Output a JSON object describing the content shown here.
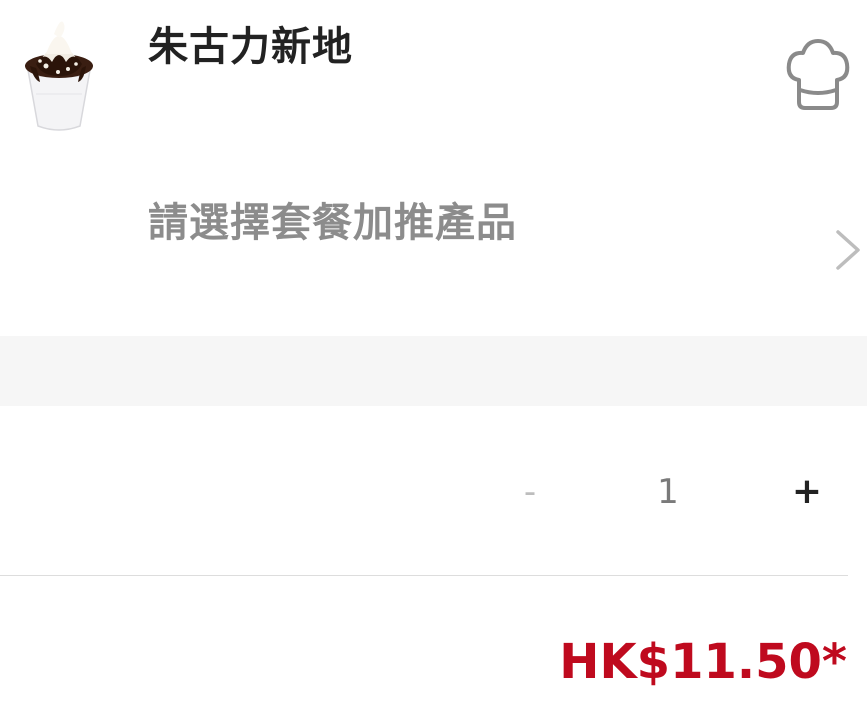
{
  "product": {
    "name": "朱古力新地",
    "image_icon": "chocolate-sundae-image"
  },
  "customize": {
    "icon": "chef-hat-icon"
  },
  "addon": {
    "label": "請選擇套餐加推產品",
    "icon": "chevron-right-icon"
  },
  "quantity": {
    "minus_label": "-",
    "value": "1",
    "plus_label": "+"
  },
  "price": {
    "text": "HK$11.50*"
  },
  "colors": {
    "price": "#bf0a1e",
    "title": "#222222",
    "muted": "#8c8c8c",
    "divider_band": "#f6f6f6"
  }
}
